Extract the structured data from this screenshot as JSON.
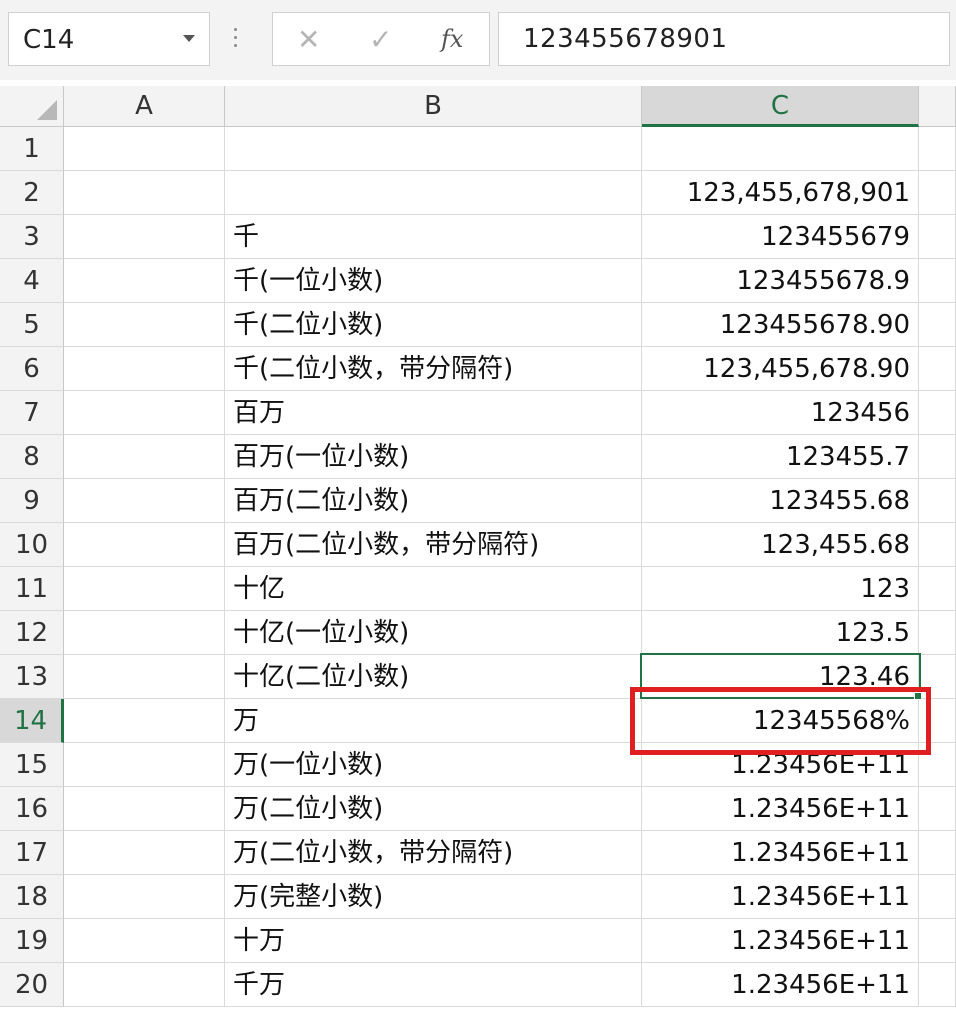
{
  "formula_bar": {
    "name_box": "C14",
    "cancel_icon": "close-icon",
    "confirm_icon": "check-icon",
    "fx_label": "fx",
    "formula_value": "123455678901"
  },
  "columns": [
    "A",
    "B",
    "C"
  ],
  "active_cell": "C14",
  "colors": {
    "accent_green": "#217346",
    "annotation_red": "#e02020"
  },
  "rows": [
    {
      "num": "1",
      "b": "",
      "c": ""
    },
    {
      "num": "2",
      "b": "",
      "c": "123,455,678,901"
    },
    {
      "num": "3",
      "b": "千",
      "c": "123455679"
    },
    {
      "num": "4",
      "b": "千(一位小数)",
      "c": "123455678.9"
    },
    {
      "num": "5",
      "b": "千(二位小数)",
      "c": "123455678.90"
    },
    {
      "num": "6",
      "b": "千(二位小数，带分隔符)",
      "c": "123,455,678.90"
    },
    {
      "num": "7",
      "b": "百万",
      "c": "123456"
    },
    {
      "num": "8",
      "b": "百万(一位小数)",
      "c": "123455.7"
    },
    {
      "num": "9",
      "b": "百万(二位小数)",
      "c": "123455.68"
    },
    {
      "num": "10",
      "b": "百万(二位小数，带分隔符)",
      "c": "123,455.68"
    },
    {
      "num": "11",
      "b": "十亿",
      "c": "123"
    },
    {
      "num": "12",
      "b": "十亿(一位小数)",
      "c": "123.5"
    },
    {
      "num": "13",
      "b": "十亿(二位小数)",
      "c": "123.46"
    },
    {
      "num": "14",
      "b": "万",
      "c": "12345568%"
    },
    {
      "num": "15",
      "b": "万(一位小数)",
      "c": "1.23456E+11"
    },
    {
      "num": "16",
      "b": "万(二位小数)",
      "c": "1.23456E+11"
    },
    {
      "num": "17",
      "b": "万(二位小数，带分隔符)",
      "c": "1.23456E+11"
    },
    {
      "num": "18",
      "b": "万(完整小数)",
      "c": "1.23456E+11"
    },
    {
      "num": "19",
      "b": "十万",
      "c": "1.23456E+11"
    },
    {
      "num": "20",
      "b": "千万",
      "c": "1.23456E+11"
    }
  ]
}
